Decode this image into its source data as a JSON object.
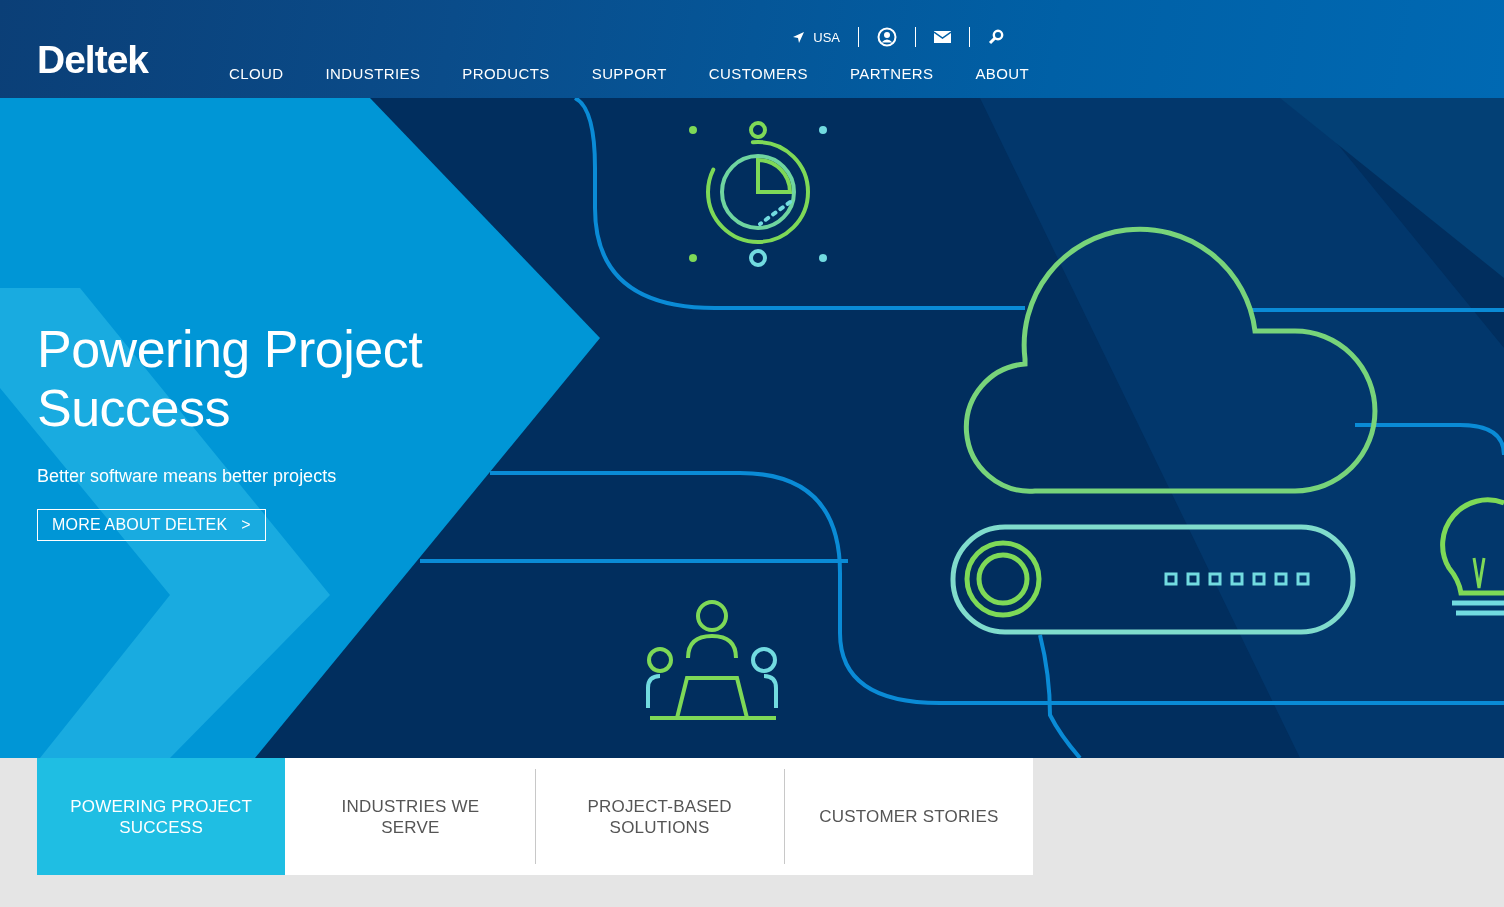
{
  "header": {
    "logo": "Deltek",
    "utility": {
      "location": "USA"
    },
    "nav": [
      "CLOUD",
      "INDUSTRIES",
      "PRODUCTS",
      "SUPPORT",
      "CUSTOMERS",
      "PARTNERS",
      "ABOUT"
    ]
  },
  "hero": {
    "title": "Powering Project Success",
    "subtitle": "Better software means better projects",
    "button": "MORE ABOUT DELTEK",
    "button_arrow": ">"
  },
  "tabs": [
    {
      "label": "POWERING PROJECT SUCCESS",
      "selected": true
    },
    {
      "label": "INDUSTRIES WE SERVE",
      "selected": false
    },
    {
      "label": "PROJECT-BASED SOLUTIONS",
      "selected": false
    },
    {
      "label": "CUSTOMER STORIES",
      "selected": false
    }
  ]
}
